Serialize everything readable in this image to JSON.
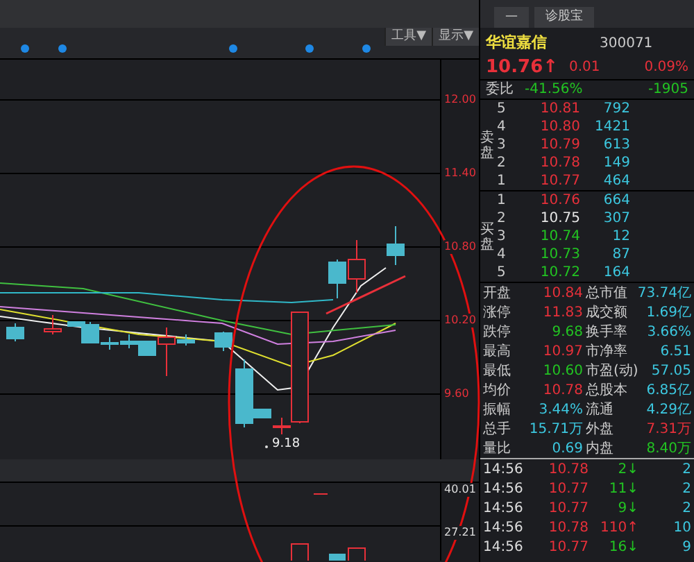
{
  "toolbar": {
    "menus": [
      "工具▼",
      "显示▼"
    ]
  },
  "chart": {
    "price_axis": [
      "12.00",
      "11.40",
      "10.80",
      "10.20",
      "9.60"
    ],
    "low_marker": "9.18",
    "volume_axis": [
      "40.01",
      "27.21"
    ]
  },
  "quote": {
    "actions": [
      "—",
      "诊股宝"
    ],
    "name": "华谊嘉信",
    "code": "300071",
    "price": "10.76",
    "price_arrow": "↑",
    "change": "0.01",
    "change_pct": "0.09%",
    "order_ratio": {
      "label": "委比",
      "percent": "-41.56%",
      "diff": "-1905"
    },
    "sell_label": "卖盘",
    "asks": [
      {
        "level": "5",
        "price": "10.81",
        "volume": "792",
        "color": "#e8303a"
      },
      {
        "level": "4",
        "price": "10.80",
        "volume": "1421",
        "color": "#e8303a"
      },
      {
        "level": "3",
        "price": "10.79",
        "volume": "613",
        "color": "#e8303a"
      },
      {
        "level": "2",
        "price": "10.78",
        "volume": "149",
        "color": "#e8303a"
      },
      {
        "level": "1",
        "price": "10.77",
        "volume": "464",
        "color": "#e8303a"
      }
    ],
    "buy_label": "买盘",
    "bids": [
      {
        "level": "1",
        "price": "10.76",
        "volume": "664",
        "color": "#e8303a"
      },
      {
        "level": "2",
        "price": "10.75",
        "volume": "307",
        "color": "#e6e6e6"
      },
      {
        "level": "3",
        "price": "10.74",
        "volume": "12",
        "color": "#22c422"
      },
      {
        "level": "4",
        "price": "10.73",
        "volume": "87",
        "color": "#22c422"
      },
      {
        "level": "5",
        "price": "10.72",
        "volume": "164",
        "color": "#22c422"
      }
    ],
    "stats": [
      {
        "label": "开盘",
        "value": "10.84",
        "color": "#e8303a"
      },
      {
        "label": "总市值",
        "value": "73.74亿",
        "color": "#3cc8e0"
      },
      {
        "label": "涨停",
        "value": "11.83",
        "color": "#e8303a"
      },
      {
        "label": "成交额",
        "value": "1.69亿",
        "color": "#3cc8e0"
      },
      {
        "label": "跌停",
        "value": "9.68",
        "color": "#22c422"
      },
      {
        "label": "换手率",
        "value": "3.66%",
        "color": "#3cc8e0"
      },
      {
        "label": "最高",
        "value": "10.97",
        "color": "#e8303a"
      },
      {
        "label": "市净率",
        "value": "6.51",
        "color": "#3cc8e0"
      },
      {
        "label": "最低",
        "value": "10.60",
        "color": "#22c422"
      },
      {
        "label": "市盈(动)",
        "value": "57.05",
        "color": "#3cc8e0"
      },
      {
        "label": "均价",
        "value": "10.78",
        "color": "#e8303a"
      },
      {
        "label": "总股本",
        "value": "6.85亿",
        "color": "#3cc8e0"
      },
      {
        "label": "振幅",
        "value": "3.44%",
        "color": "#3cc8e0"
      },
      {
        "label": "流通",
        "value": "4.29亿",
        "color": "#3cc8e0"
      },
      {
        "label": "总手",
        "value": "15.71万",
        "color": "#3cc8e0"
      },
      {
        "label": "外盘",
        "value": "7.31万",
        "color": "#e8303a"
      },
      {
        "label": "量比",
        "value": "0.69",
        "color": "#3cc8e0"
      },
      {
        "label": "内盘",
        "value": "8.40万",
        "color": "#22c422"
      }
    ],
    "trades": [
      {
        "time": "14:56",
        "price": "10.78",
        "volume": "2↓",
        "color": "#22c422",
        "count": "2"
      },
      {
        "time": "14:56",
        "price": "10.77",
        "volume": "11↓",
        "color": "#22c422",
        "count": "2"
      },
      {
        "time": "14:56",
        "price": "10.77",
        "volume": "9↓",
        "color": "#22c422",
        "count": "2"
      },
      {
        "time": "14:56",
        "price": "10.78",
        "volume": "110↑",
        "color": "#e8303a",
        "count": "10"
      },
      {
        "time": "14:56",
        "price": "10.77",
        "volume": "16↓",
        "color": "#22c422",
        "count": "9"
      }
    ]
  }
}
